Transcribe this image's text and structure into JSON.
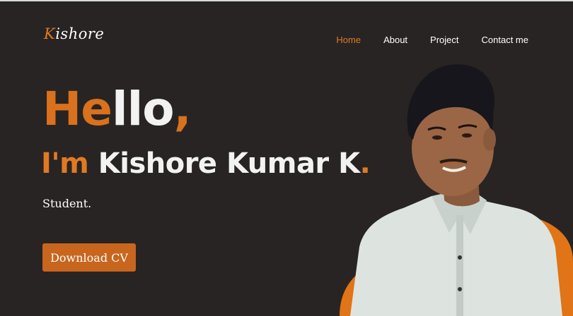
{
  "header": {
    "logo_initial": "K",
    "logo_rest": "ishore"
  },
  "nav": {
    "items": [
      {
        "label": "Home",
        "active": true
      },
      {
        "label": "About",
        "active": false
      },
      {
        "label": "Project",
        "active": false
      },
      {
        "label": "Contact me",
        "active": false
      }
    ]
  },
  "hero": {
    "greeting_orange": "He",
    "greeting_white": "llo",
    "greeting_comma": ",",
    "intro_prefix": "I'm ",
    "intro_name": "Kishore Kumar K",
    "intro_dot": ".",
    "role": "Student.",
    "cta_label": "Download CV"
  },
  "colors": {
    "background": "#282423",
    "accent": "#e07a22",
    "text": "#f2f2f2"
  }
}
